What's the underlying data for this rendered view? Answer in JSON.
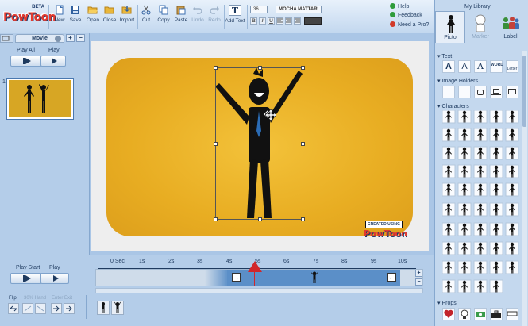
{
  "app": {
    "logo": "PowToon",
    "beta": "BETA"
  },
  "toolbar": {
    "buttons": [
      {
        "label": "New",
        "icon": "new-document-icon"
      },
      {
        "label": "Save",
        "icon": "save-disk-icon"
      },
      {
        "label": "Open",
        "icon": "open-folder-icon"
      },
      {
        "label": "Close",
        "icon": "close-folder-icon"
      },
      {
        "label": "Import",
        "icon": "import-icon"
      },
      {
        "label": "Cut",
        "icon": "scissors-icon"
      },
      {
        "label": "Copy",
        "icon": "copy-icon"
      },
      {
        "label": "Paste",
        "icon": "paste-icon"
      },
      {
        "label": "Undo",
        "icon": "undo-icon"
      },
      {
        "label": "Redo",
        "icon": "redo-icon"
      },
      {
        "label": "Add Text",
        "icon": "text-T-icon"
      }
    ],
    "font_size": "36",
    "font_name": "MOCHA MATTARI",
    "format_buttons": [
      "B",
      "I",
      "U"
    ],
    "help": [
      {
        "label": "Help",
        "color": "#2e9b3a"
      },
      {
        "label": "Feedback",
        "color": "#2e9b3a"
      },
      {
        "label": "Need a Pro?",
        "color": "#d13a2a"
      }
    ]
  },
  "left_panel": {
    "tab": "Movie",
    "play_all_label": "Play All",
    "play_label": "Play",
    "slide_number": "1"
  },
  "library": {
    "title": "My Library",
    "tabs": [
      "Picto",
      "Marker",
      "Label"
    ],
    "sections": [
      {
        "label": "Text",
        "items": [
          "A",
          "A",
          "A",
          "WORD",
          "Letter"
        ]
      },
      {
        "label": "Image Holders"
      },
      {
        "label": "Characters"
      },
      {
        "label": "Props"
      }
    ]
  },
  "stage": {
    "watermark": [
      "CREATED USING",
      "PowToon"
    ]
  },
  "timeline": {
    "play_start_label": "Play Start",
    "play_label": "Play",
    "ticks": [
      "0 Sec",
      "1s",
      "2s",
      "3s",
      "4s",
      "5s",
      "6s",
      "7s",
      "8s",
      "9s",
      "10s"
    ],
    "bottom_labels": [
      "Flip",
      "30% Hand",
      "Enter Exit"
    ]
  },
  "colors": {
    "accent_red": "#d1262a",
    "stage_yellow": "#e8ad22",
    "timeline_blue": "#5b8fc8"
  }
}
